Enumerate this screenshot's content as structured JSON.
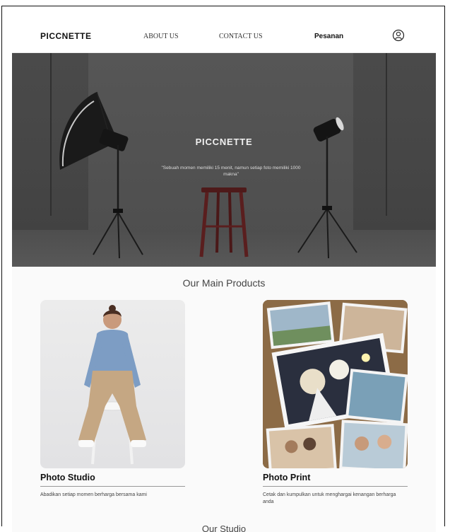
{
  "nav": {
    "brand": "PICCNETTE",
    "about_label": "ABOUT US",
    "contact_label": "CONTACT US",
    "order_label": "Pesanan",
    "user_icon": "user-icon"
  },
  "hero": {
    "title": "PICCNETTE",
    "quote": "\"Sebuah momen memiliki 15 menit, namun setiap foto memiliki 1000 makna\""
  },
  "products": {
    "heading": "Our Main Products",
    "items": [
      {
        "name": "Photo Studio",
        "description": "Abadikan setiap momen berharga bersama kami"
      },
      {
        "name": "Photo Print",
        "description": "Cetak dan kumpulkan untuk menghargai kenangan berharga anda"
      }
    ]
  },
  "studio": {
    "heading": "Our Studio"
  },
  "colors": {
    "hero_background": "#4a4a4a",
    "accent_stool": "#5a1e1e",
    "text_dark": "#111111"
  }
}
